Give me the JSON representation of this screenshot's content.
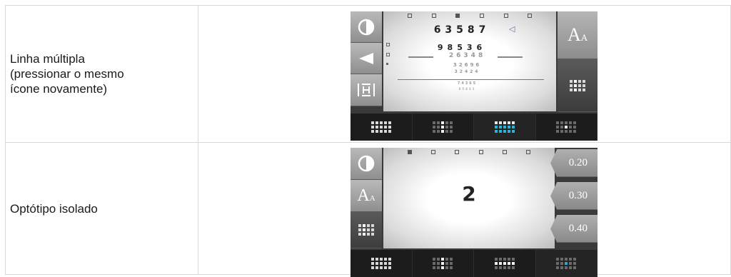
{
  "rows": [
    {
      "label": "Linha múltipla\n(pressionar o mesmo\nícone novamente)",
      "chart_lines": [
        "63587",
        "98536",
        "26348",
        "32696",
        "32424",
        "74365",
        "85431"
      ]
    },
    {
      "label": "Optótipo isolado",
      "single_optotype": "2",
      "acuity_values": [
        "0.20",
        "0.30",
        "0.40"
      ]
    }
  ],
  "icons": {
    "contrast": "contrast-icon",
    "arrow": "arrow-left-icon",
    "hi": "horizontal-split-icon",
    "font_size": "A",
    "font_size_small": "A",
    "grid": "grid-icon"
  },
  "colors": {
    "accent": "#23b6d9"
  }
}
